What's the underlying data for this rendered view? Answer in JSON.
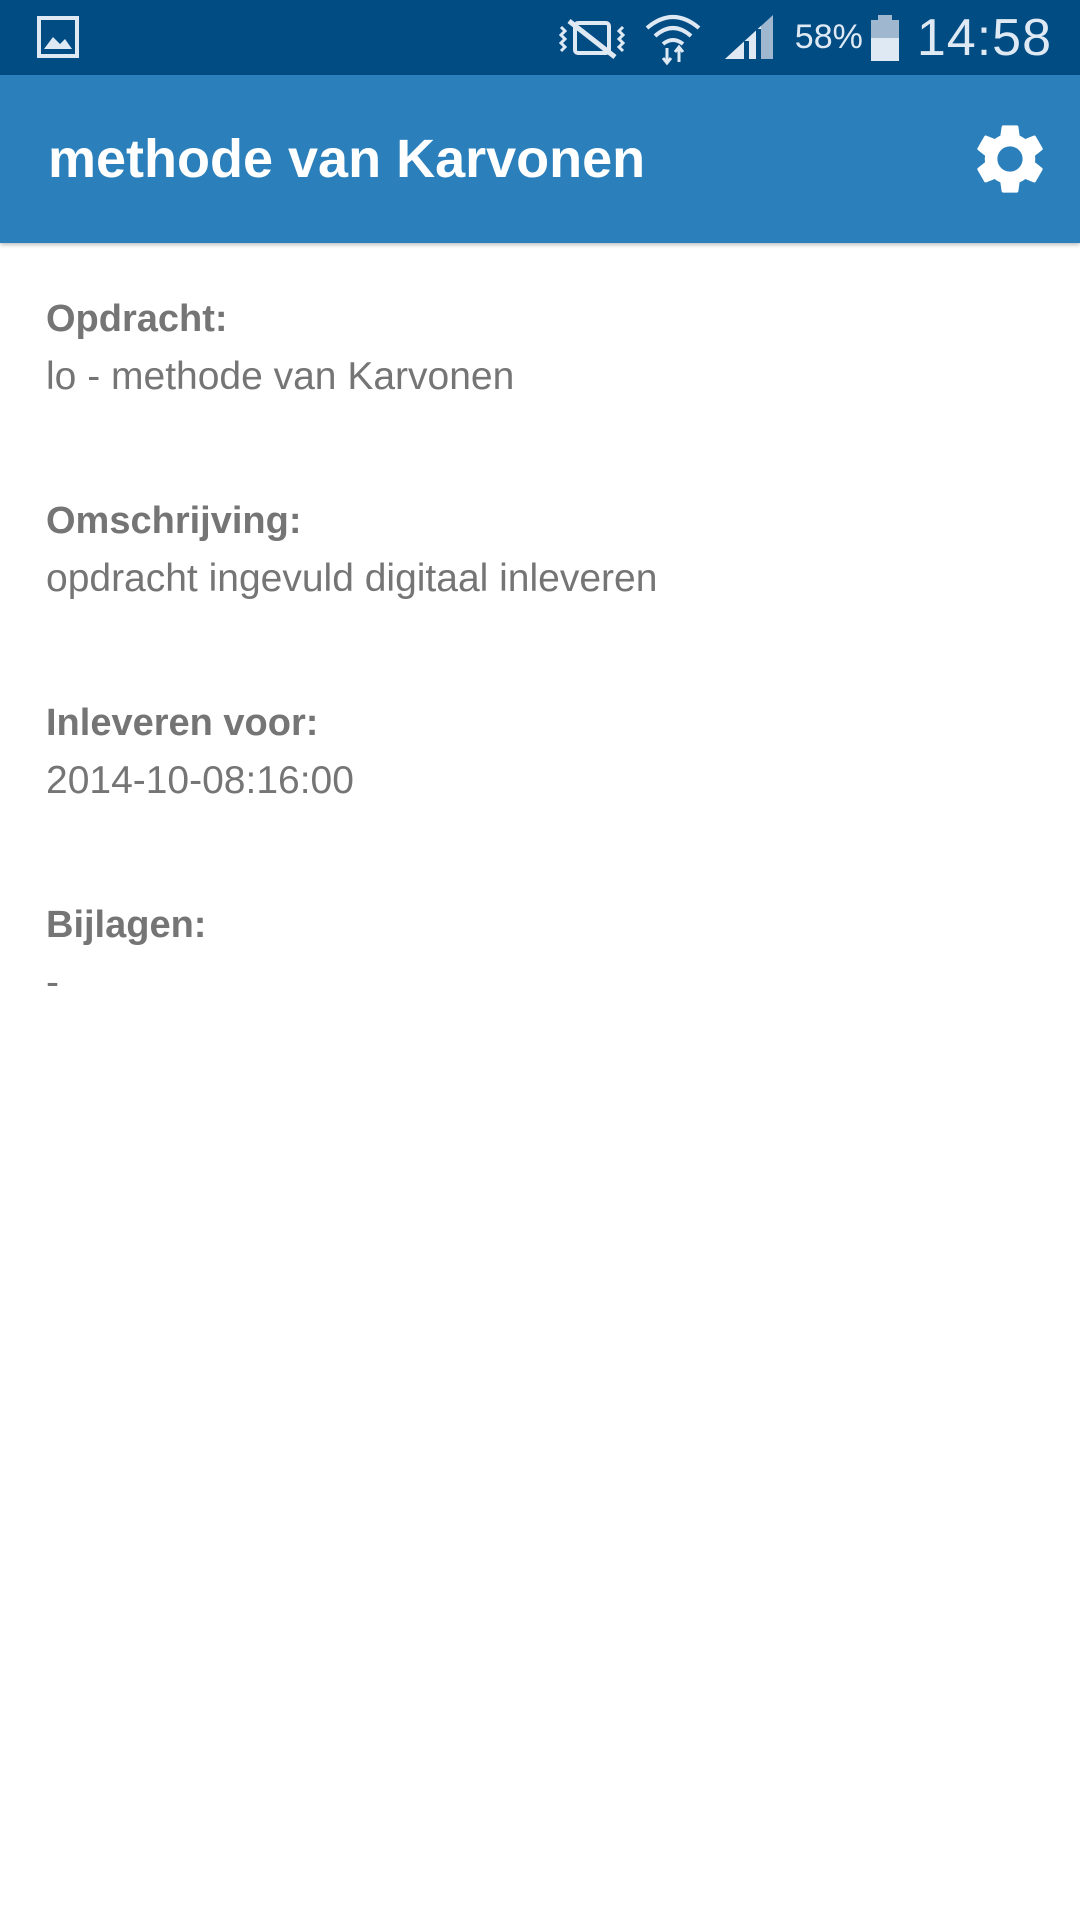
{
  "status_bar": {
    "left_icon": "gallery-icon",
    "icons": [
      "vibrate-mute-icon",
      "wifi-icon",
      "signal-icon",
      "battery-icon"
    ],
    "battery_percent": "58%",
    "time": "14:58"
  },
  "app_bar": {
    "title": "methode van Karvonen",
    "settings_icon": "gear-icon",
    "color": "#2b80bb"
  },
  "colors": {
    "status_bar": "#024c84",
    "app_bar": "#2b80bb",
    "text": "#757575"
  },
  "details": {
    "assignment": {
      "label": "Opdracht:",
      "value": "lo - methode van Karvonen"
    },
    "description": {
      "label": "Omschrijving:",
      "value": "opdracht ingevuld digitaal inleveren"
    },
    "due": {
      "label": "Inleveren voor:",
      "value": "2014-10-08:16:00"
    },
    "attachments": {
      "label": "Bijlagen:",
      "value": "-"
    }
  }
}
